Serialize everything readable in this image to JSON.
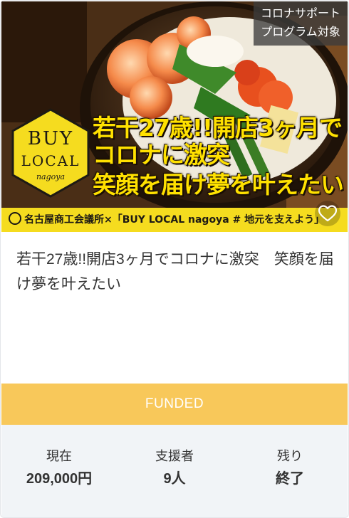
{
  "project": {
    "badge": [
      "コロナサポート",
      "プログラム対象"
    ],
    "image": {
      "headline_lines": [
        "若干27歳!!開店3ヶ月で",
        "コロナに激突",
        "笑顔を届け夢を叶えたい"
      ],
      "logo_lines": [
        "BUY",
        "LOCAL",
        "nagoya"
      ],
      "banner_strip": "名古屋商工会議所×「BUY LOCAL nagoya # 地元を支えよう」"
    },
    "title": "若干27歳!!開店3ヶ月でコロナに激突　笑顔を届け夢を叶えたい",
    "status": "FUNDED",
    "stats": [
      {
        "label": "現在",
        "value": "209,000円"
      },
      {
        "label": "支援者",
        "value": "9人"
      },
      {
        "label": "残り",
        "value": "終了"
      }
    ],
    "favorite_icon": "heart-icon"
  },
  "colors": {
    "status_bar": "#f8c85a",
    "stats_background": "#f1f4f7",
    "promo_text": "#ffe100",
    "banner_yellow": "#f5dc1f"
  }
}
